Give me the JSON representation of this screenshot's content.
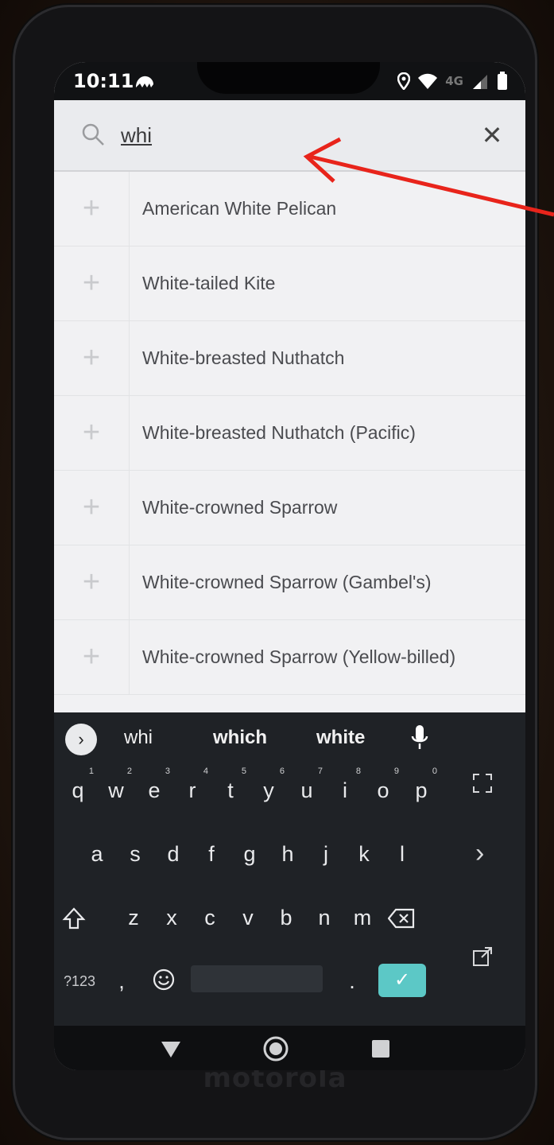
{
  "status": {
    "time": "10:11",
    "network": "4G"
  },
  "search": {
    "value": "whi",
    "placeholder": ""
  },
  "results": [
    {
      "name": "American White Pelican"
    },
    {
      "name": "White-tailed Kite"
    },
    {
      "name": "White-breasted Nuthatch"
    },
    {
      "name": "White-breasted Nuthatch (Pacific)"
    },
    {
      "name": "White-crowned Sparrow"
    },
    {
      "name": "White-crowned Sparrow (Gambel's)"
    },
    {
      "name": "White-crowned Sparrow (Yellow-billed)"
    }
  ],
  "keyboard": {
    "suggestions": [
      "whi",
      "which",
      "white"
    ],
    "row1": [
      "q",
      "w",
      "e",
      "r",
      "t",
      "y",
      "u",
      "i",
      "o",
      "p"
    ],
    "row1_digits": [
      "1",
      "2",
      "3",
      "4",
      "5",
      "6",
      "7",
      "8",
      "9",
      "0"
    ],
    "row2": [
      "a",
      "s",
      "d",
      "f",
      "g",
      "h",
      "j",
      "k",
      "l"
    ],
    "row3": [
      "z",
      "x",
      "c",
      "v",
      "b",
      "n",
      "m"
    ],
    "symbols_label": "?123",
    "comma": ",",
    "period": "."
  },
  "phone": {
    "brand": "motorola"
  },
  "colors": {
    "accent": "#5cc8c6",
    "annotation_arrow": "#e8241b"
  }
}
